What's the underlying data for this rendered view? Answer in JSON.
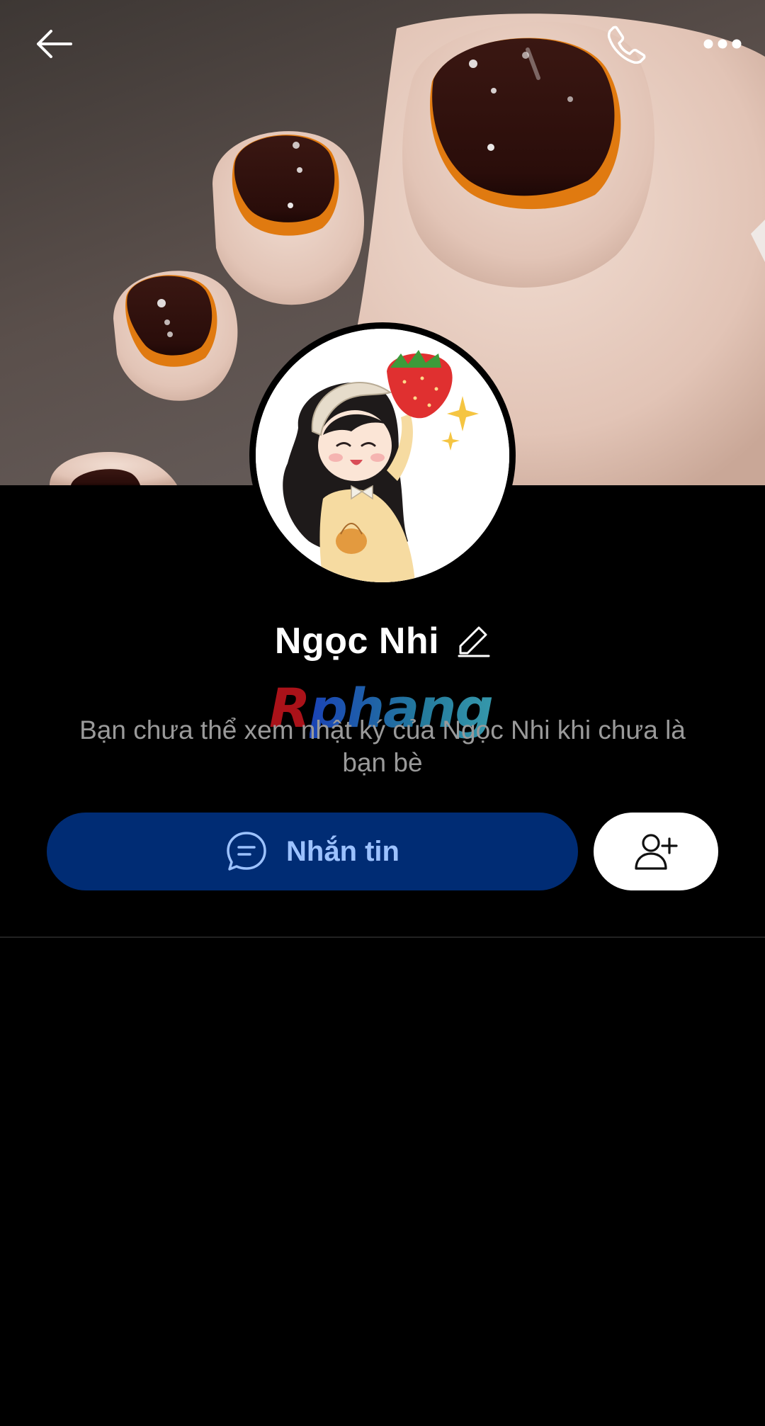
{
  "header": {
    "back_icon": "arrow-left-icon",
    "call_icon": "phone-icon",
    "more_icon": "more-horizontal-icon"
  },
  "profile": {
    "name": "Ngọc Nhi",
    "edit_icon": "pencil-icon",
    "avatar": "avatar-girl-strawberry"
  },
  "watermark": {
    "first": "R",
    "rest": "phang"
  },
  "notice": {
    "text": "Bạn chưa thể xem nhật ký của Ngọc Nhi khi chưa là bạn bè"
  },
  "actions": {
    "message_label": "Nhắn tin",
    "message_icon": "chat-bubble-icon",
    "add_friend_icon": "user-plus-icon"
  },
  "colors": {
    "background": "#000000",
    "message_button": "#002c74",
    "message_text": "#9cc2ff",
    "description_text": "#9a9a9a",
    "nail_polish": "#2e0f0c",
    "nail_tip": "#e07a10"
  }
}
